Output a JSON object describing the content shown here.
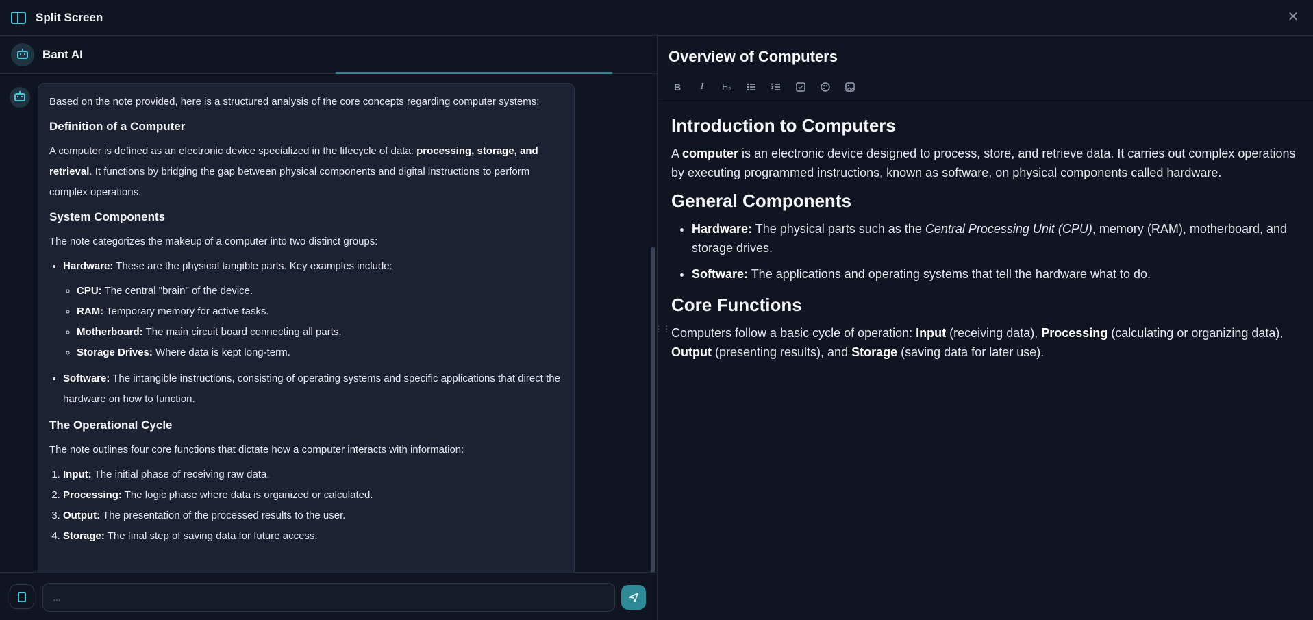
{
  "window": {
    "title": "Split Screen",
    "close_icon": "close-icon",
    "accent_color": "#4fc3d9"
  },
  "chat": {
    "bot_name": "Bant AI",
    "message": {
      "intro": "Based on the note provided, here is a structured analysis of the core concepts regarding computer systems:",
      "definition_heading": "Definition of a Computer",
      "definition_pre": "A computer is defined as an electronic device specialized in the lifecycle of data: ",
      "definition_bold": "processing, storage, and retrieval",
      "definition_post": ". It functions by bridging the gap between physical components and digital instructions to perform complex operations.",
      "components_heading": "System Components",
      "components_intro": "The note categorizes the makeup of a computer into two distinct groups:",
      "hardware_label": "Hardware:",
      "hardware_text": " These are the physical tangible parts. Key examples include:",
      "hardware_items": [
        {
          "label": "CPU:",
          "text": " The central \"brain\" of the device."
        },
        {
          "label": "RAM:",
          "text": " Temporary memory for active tasks."
        },
        {
          "label": "Motherboard:",
          "text": " The main circuit board connecting all parts."
        },
        {
          "label": "Storage Drives:",
          "text": " Where data is kept long-term."
        }
      ],
      "software_label": "Software:",
      "software_text": " The intangible instructions, consisting of operating systems and specific applications that direct the hardware on how to function.",
      "cycle_heading": "The Operational Cycle",
      "cycle_intro": "The note outlines four core functions that dictate how a computer interacts with information:",
      "cycle_items": [
        {
          "label": "Input:",
          "text": " The initial phase of receiving raw data."
        },
        {
          "label": "Processing:",
          "text": " The logic phase where data is organized or calculated."
        },
        {
          "label": "Output:",
          "text": " The presentation of the processed results to the user."
        },
        {
          "label": "Storage:",
          "text": " The final step of saving data for future access."
        }
      ]
    },
    "composer": {
      "placeholder": "...",
      "value": ""
    }
  },
  "editor": {
    "title": "Overview of Computers",
    "toolbar": [
      "B",
      "I",
      "H2",
      "bullet-list",
      "numbered-list",
      "checkbox",
      "palette",
      "image"
    ],
    "content": {
      "h_intro": "Introduction to Computers",
      "intro_pre": "A ",
      "intro_bold": "computer",
      "intro_post": " is an electronic device designed to process, store, and retrieve data. It carries out complex operations by executing programmed instructions, known as software, on physical components called hardware.",
      "h_components": "General Components",
      "hw_label": "Hardware:",
      "hw_pre": " The physical parts such as the ",
      "hw_italic": "Central Processing Unit (CPU)",
      "hw_post": ", memory (RAM), motherboard, and storage drives.",
      "sw_label": "Software:",
      "sw_text": " The applications and operating systems that tell the hardware what to do.",
      "h_functions": "Core Functions",
      "f_pre": "Computers follow a basic cycle of operation: ",
      "f_input": "Input",
      "f_1": " (receiving data), ",
      "f_processing": "Processing",
      "f_2": " (calculating or organizing data), ",
      "f_output": "Output",
      "f_3": " (presenting results), and ",
      "f_storage": "Storage",
      "f_4": " (saving data for later use)."
    }
  }
}
